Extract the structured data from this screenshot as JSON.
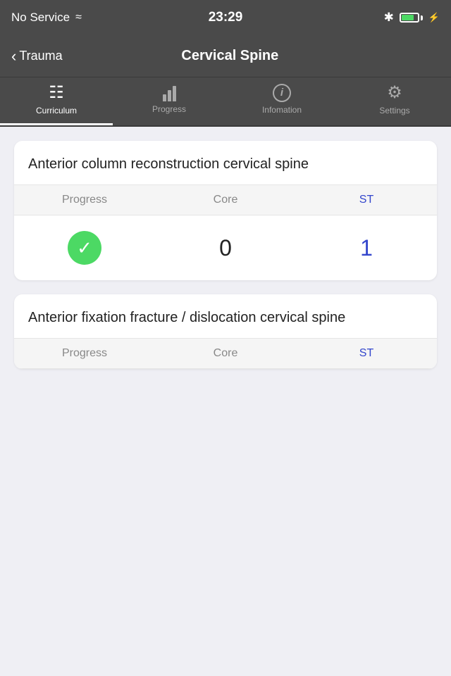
{
  "statusBar": {
    "carrier": "No Service",
    "time": "23:29",
    "bluetooth": "✱",
    "battery_level": 80
  },
  "navBar": {
    "backLabel": "Trauma",
    "title": "Cervical Spine"
  },
  "tabs": [
    {
      "id": "curriculum",
      "label": "Curriculum",
      "icon": "doc",
      "active": true
    },
    {
      "id": "progress",
      "label": "Progress",
      "icon": "bar-chart",
      "active": false
    },
    {
      "id": "information",
      "label": "Infomation",
      "icon": "info",
      "active": false
    },
    {
      "id": "settings",
      "label": "Settings",
      "icon": "gear",
      "active": false
    }
  ],
  "cards": [
    {
      "id": "card1",
      "title": "Anterior column reconstruction cervical spine",
      "columns": [
        "Progress",
        "Core",
        "ST"
      ],
      "rows": [
        {
          "progress_done": true,
          "core": "0",
          "st": "1"
        }
      ]
    },
    {
      "id": "card2",
      "title": "Anterior fixation fracture / dislocation cervical spine",
      "columns": [
        "Progress",
        "Core",
        "ST"
      ],
      "rows": []
    }
  ]
}
